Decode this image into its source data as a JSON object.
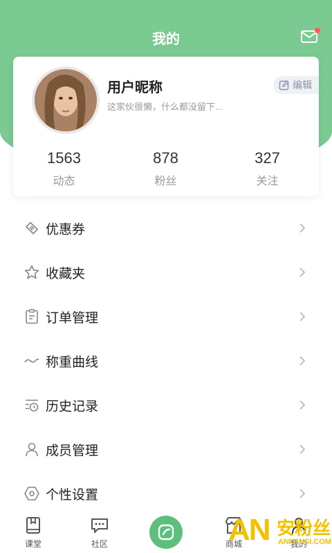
{
  "header": {
    "title": "我的"
  },
  "profile": {
    "nickname": "用户昵称",
    "bio": "这家伙很懒，什么都没留下...",
    "edit_label": "编辑",
    "stats": [
      {
        "value": "1563",
        "label": "动态"
      },
      {
        "value": "878",
        "label": "粉丝"
      },
      {
        "value": "327",
        "label": "关注"
      }
    ]
  },
  "menu": {
    "items": [
      {
        "label": "优惠券",
        "icon": "coupon-icon"
      },
      {
        "label": "收藏夹",
        "icon": "star-icon"
      },
      {
        "label": "订单管理",
        "icon": "clipboard-icon"
      },
      {
        "label": "称重曲线",
        "icon": "curve-icon"
      },
      {
        "label": "历史记录",
        "icon": "history-icon"
      },
      {
        "label": "成员管理",
        "icon": "person-icon"
      },
      {
        "label": "个性设置",
        "icon": "hexagon-icon"
      }
    ]
  },
  "tabbar": {
    "items": [
      {
        "label": "课堂",
        "icon": "book-icon"
      },
      {
        "label": "社区",
        "icon": "chat-icon"
      },
      {
        "label": "",
        "icon": "center-action-icon"
      },
      {
        "label": "商城",
        "icon": "store-icon"
      },
      {
        "label": "我的",
        "icon": "user-icon"
      }
    ]
  },
  "watermark": {
    "brand": "AN",
    "cn": "安粉丝",
    "url": "ANFENSI.COM"
  },
  "colors": {
    "accent": "#7bca92",
    "center_button": "#5cc07c",
    "badge": "#ff5a5a"
  }
}
